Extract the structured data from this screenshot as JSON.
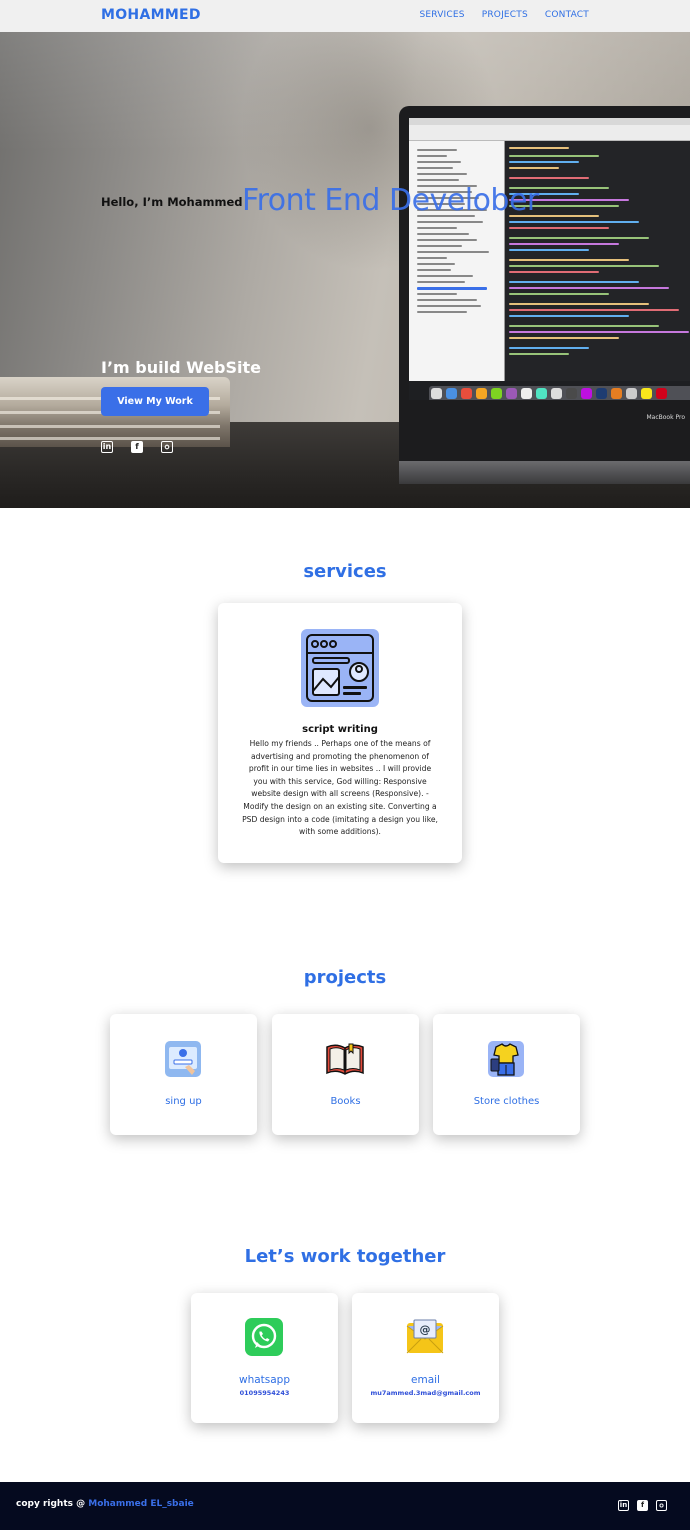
{
  "nav": {
    "logo": "MOHAMMED",
    "links": [
      "SERVICES",
      "PROJECTS",
      "CONTACT"
    ]
  },
  "hero": {
    "greeting": "Hello, I’m Mohammed",
    "role": "Front End Develober",
    "tagline": "I’m build WebSite",
    "button_label": "View My Work",
    "laptop_brand": "MacBook Pro",
    "social_icons": [
      "linkedin-icon",
      "facebook-icon",
      "instagram-icon"
    ]
  },
  "services": {
    "title": "services",
    "items": [
      {
        "icon": "web-design-icon",
        "name": "script writing",
        "description": "Hello my friends .. Perhaps one of the means of advertising and promoting the phenomenon of profit in our time lies in websites .. I will provide you with this service, God willing: Responsive website design with all screens (Responsive). - Modify the design on an existing site. Converting a PSD design into a code (imitating a design you like, with some additions)."
      }
    ]
  },
  "projects": {
    "title": "projects",
    "items": [
      {
        "label": "sing up",
        "icon": "signup-icon"
      },
      {
        "label": "Books",
        "icon": "book-icon"
      },
      {
        "label": "Store clothes",
        "icon": "clothes-icon"
      }
    ]
  },
  "contact": {
    "title": "Let’s work together",
    "items": [
      {
        "label": "whatsapp",
        "value": "01095954243",
        "icon": "whatsapp-icon"
      },
      {
        "label": "email",
        "value": "mu7ammed.3mad@gmail.com",
        "icon": "email-icon"
      }
    ]
  },
  "footer": {
    "prefix": "copy rights @ ",
    "name": "Mohammed EL_sbaie",
    "social_icons": [
      "linkedin-icon",
      "facebook-icon",
      "instagram-icon"
    ]
  },
  "colors": {
    "accent": "#2f6fe4",
    "button": "#3a6fe8",
    "footer_bg": "#050a1f",
    "nav_bg": "#f0f0f0"
  }
}
